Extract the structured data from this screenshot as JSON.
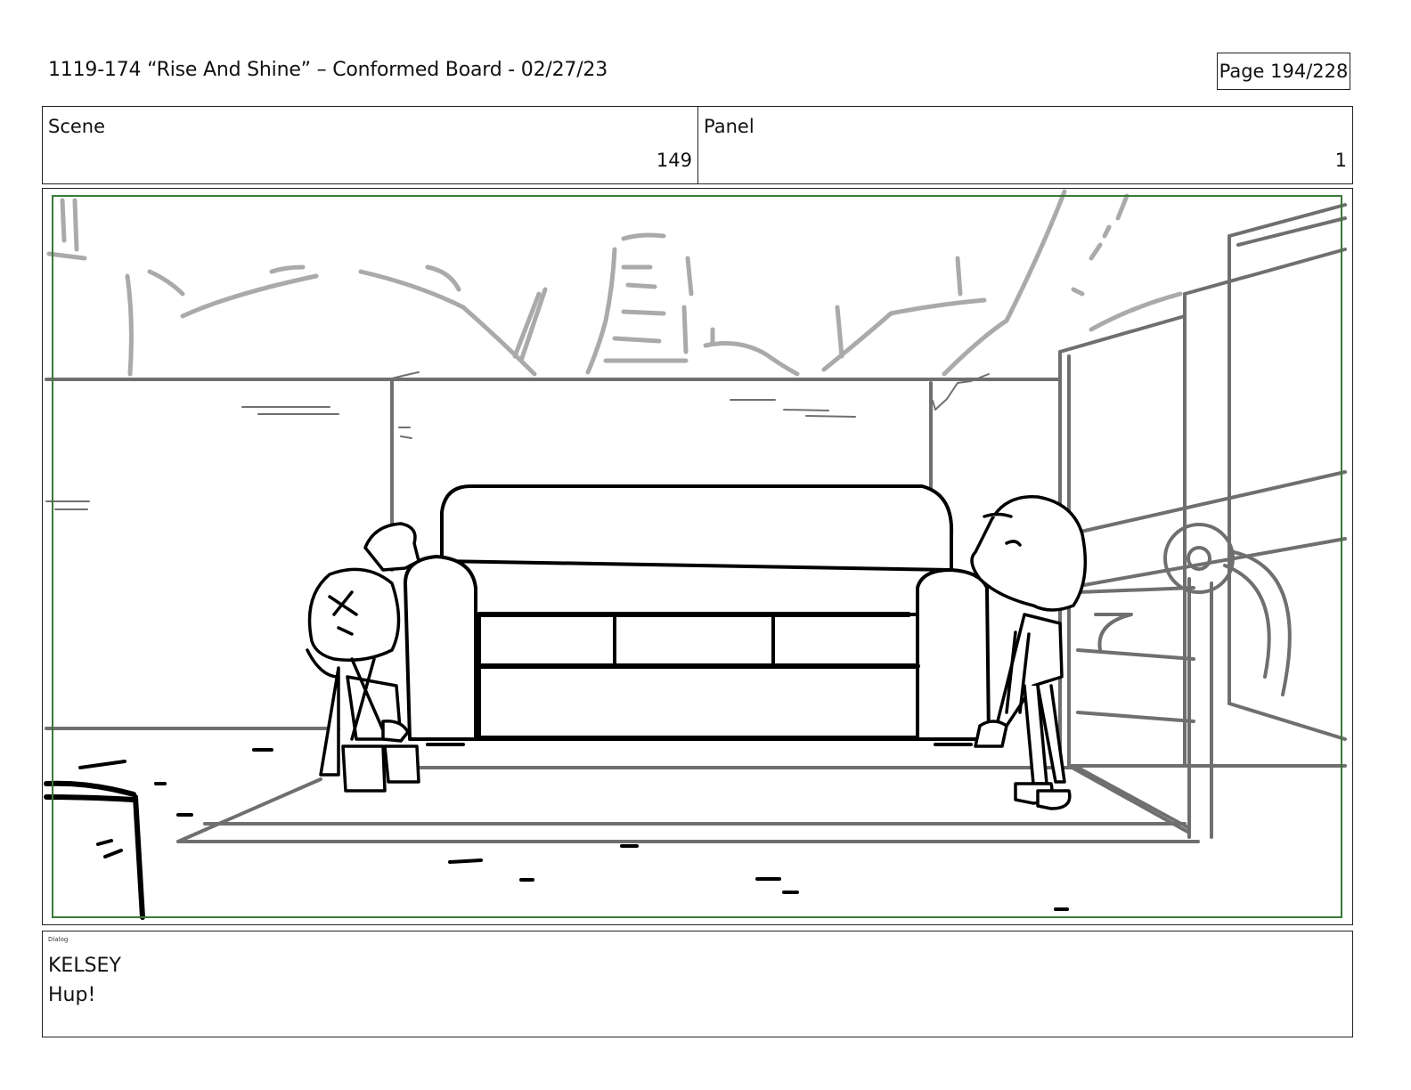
{
  "header": {
    "title": "1119-174 “Rise And Shine” – Conformed Board - 02/27/23",
    "page": "Page 194/228"
  },
  "info": {
    "scene_label": "Scene",
    "scene_value": "149",
    "panel_label": "Panel",
    "panel_value": "1"
  },
  "dialog": {
    "tag": "Dialog",
    "character": "KELSEY",
    "line": "Hup!"
  },
  "colors": {
    "safe_frame": "#3a7a3a",
    "sketch_light": "#aaaaaa",
    "sketch_mid": "#6f6f6f",
    "ink": "#000000"
  }
}
